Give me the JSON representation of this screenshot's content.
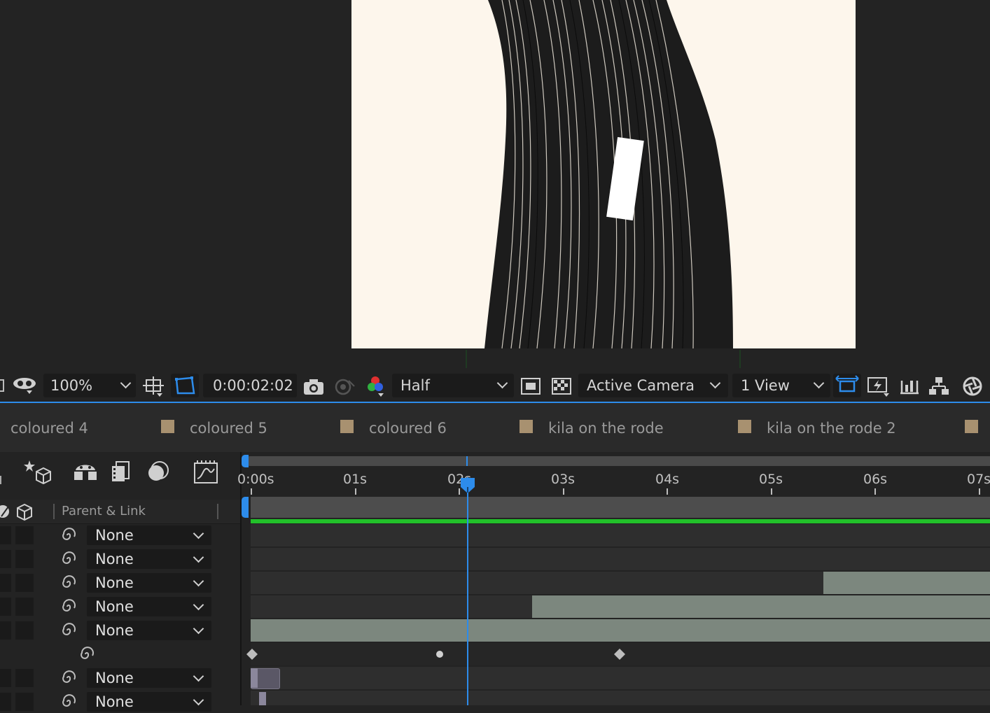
{
  "viewer_toolbar": {
    "zoom": "100%",
    "timecode": "0:00:02:02",
    "resolution": "Half",
    "camera": "Active Camera",
    "views": "1 View"
  },
  "comp_tabs": [
    {
      "label": "coloured 4"
    },
    {
      "label": "coloured 5"
    },
    {
      "label": "coloured 6"
    },
    {
      "label": "kila on the rode"
    },
    {
      "label": "kila on the rode 2"
    }
  ],
  "timeline": {
    "column_header": "Parent & Link",
    "ruler": [
      "0:00s",
      "01s",
      "02s",
      "03s",
      "04s",
      "05s",
      "06s",
      "07s"
    ],
    "current_time_seconds": 2.05,
    "layers": [
      {
        "parent": "None"
      },
      {
        "parent": "None"
      },
      {
        "parent": "None"
      },
      {
        "parent": "None"
      },
      {
        "parent": "None"
      },
      {
        "parent": "None"
      },
      {
        "parent": "None"
      }
    ]
  },
  "colors": {
    "accent": "#2d8ceb",
    "work_area": "#22c02a",
    "layer_bar": "#7c877e",
    "label_swatch": "#a89170"
  }
}
